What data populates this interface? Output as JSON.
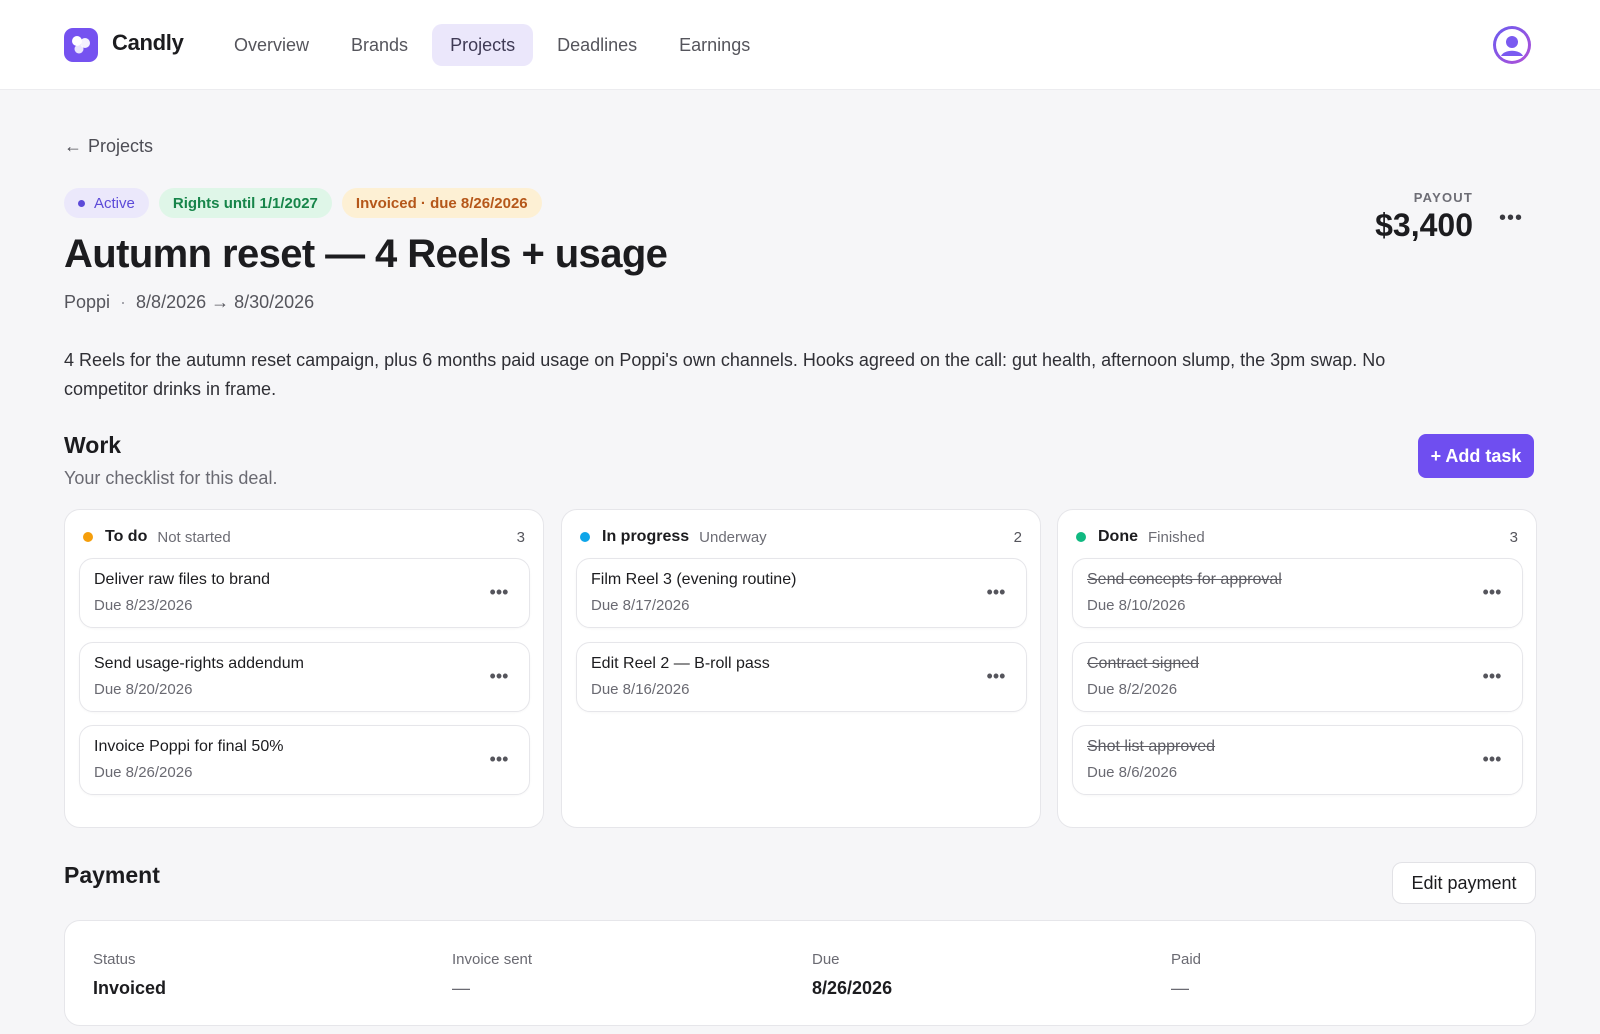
{
  "app": {
    "name": "Candly"
  },
  "nav": {
    "items": [
      {
        "label": "Overview",
        "active": false
      },
      {
        "label": "Brands",
        "active": false
      },
      {
        "label": "Projects",
        "active": true
      },
      {
        "label": "Deadlines",
        "active": false
      },
      {
        "label": "Earnings",
        "active": false
      }
    ]
  },
  "breadcrumb": {
    "arrow": "←",
    "label": "Projects"
  },
  "project": {
    "badges": {
      "status": "Active",
      "rights": "Rights until 1/1/2027",
      "invoice": "Invoiced · due 8/26/2026"
    },
    "title": "Autumn reset — 4 Reels + usage",
    "brand": "Poppi",
    "meta_separator": "·",
    "date_range": "8/8/2026 → 8/30/2026",
    "payout_label": "PAYOUT",
    "payout": "$3,400",
    "description": "4 Reels for the autumn reset campaign, plus 6 months paid usage on Poppi's own channels. Hooks agreed on the call: gut health, afternoon slump, the 3pm swap. No competitor drinks in frame."
  },
  "work": {
    "title": "Work",
    "subtitle": "Your checklist for this deal.",
    "add_task_label": "+ Add task",
    "columns": [
      {
        "name": "To do",
        "status": "Not started",
        "count": "3",
        "color": "#f59e0b",
        "tasks": [
          {
            "title": "Deliver raw files to brand",
            "due": "Due 8/23/2026"
          },
          {
            "title": "Send usage-rights addendum",
            "due": "Due 8/20/2026"
          },
          {
            "title": "Invoice Poppi for final 50%",
            "due": "Due 8/26/2026"
          }
        ]
      },
      {
        "name": "In progress",
        "status": "Underway",
        "count": "2",
        "color": "#0ea5e9",
        "tasks": [
          {
            "title": "Film Reel 3 (evening routine)",
            "due": "Due 8/17/2026"
          },
          {
            "title": "Edit Reel 2 — B-roll pass",
            "due": "Due 8/16/2026"
          }
        ]
      },
      {
        "name": "Done",
        "status": "Finished",
        "count": "3",
        "color": "#10b981",
        "tasks": [
          {
            "title": "Send concepts for approval",
            "due": "Due 8/10/2026"
          },
          {
            "title": "Contract signed",
            "due": "Due 8/2/2026"
          },
          {
            "title": "Shot list approved",
            "due": "Due 8/6/2026"
          }
        ]
      }
    ]
  },
  "payment": {
    "title": "Payment",
    "edit_label": "Edit payment",
    "fields": [
      {
        "label": "Status",
        "value": "Invoiced"
      },
      {
        "label": "Invoice sent",
        "value": "—"
      },
      {
        "label": "Due",
        "value": "8/26/2026"
      },
      {
        "label": "Paid",
        "value": "—"
      }
    ]
  },
  "icons": {
    "more": "more-horizontal-icon",
    "back": "arrow-left-icon",
    "avatar": "user-icon"
  },
  "colors": {
    "accent": "#6f4ef0",
    "active_badge_bg": "#ebe8fb",
    "rights_badge_bg": "#dff6e8",
    "invoice_badge_bg": "#fdf0d4"
  }
}
